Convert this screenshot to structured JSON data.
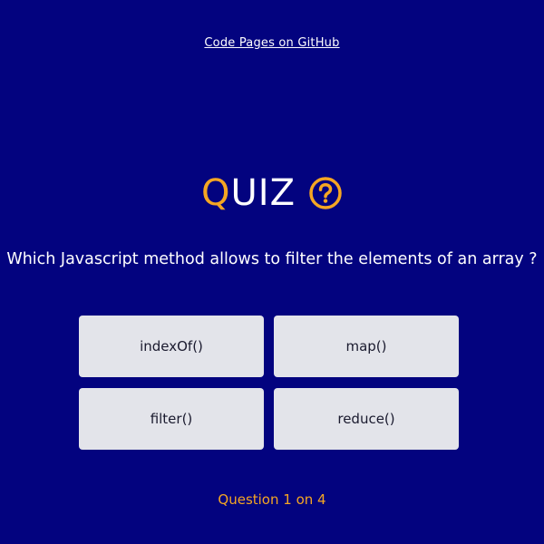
{
  "header": {
    "link_label": "Code Pages on GitHub"
  },
  "title": {
    "first_letter": "Q",
    "rest": "UIZ",
    "icon": "question-circle-icon"
  },
  "quiz": {
    "question": "Which Javascript method allows to filter the elements of an array ?",
    "answers": [
      {
        "label": "indexOf()"
      },
      {
        "label": "map()"
      },
      {
        "label": "filter()"
      },
      {
        "label": "reduce()"
      }
    ],
    "progress_text": "Question 1 on 4"
  },
  "colors": {
    "background": "#03037f",
    "accent": "#f5a623",
    "answer_bg": "#e3e4ea",
    "text": "#ffffff"
  }
}
